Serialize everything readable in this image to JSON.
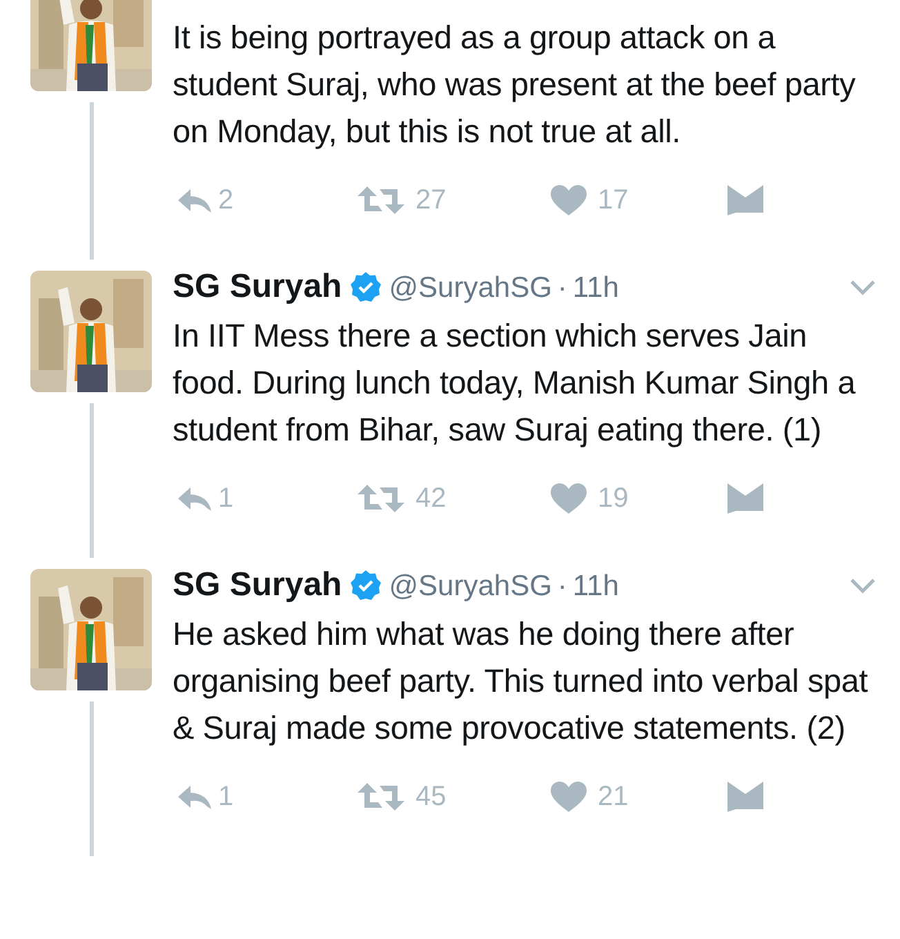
{
  "tweets": [
    {
      "text": "It is being portrayed as a group attack on a student Suraj, who was present at the beef party on Monday, but this is not true at all.",
      "replies": "2",
      "retweets": "27",
      "likes": "17"
    },
    {
      "author": "SG Suryah",
      "verified": true,
      "handle": "@SuryahSG",
      "separator": "·",
      "time": "11h",
      "text": "In IIT Mess there a section which serves Jain food. During lunch today, Manish Kumar Singh a student from Bihar, saw Suraj eating there. (1)",
      "replies": "1",
      "retweets": "42",
      "likes": "19"
    },
    {
      "author": "SG Suryah",
      "verified": true,
      "handle": "@SuryahSG",
      "separator": "·",
      "time": "11h",
      "text": "He asked him what was he doing there after organising beef party. This turned into verbal spat & Suraj made some provocative statements. (2)",
      "replies": "1",
      "retweets": "45",
      "likes": "21"
    }
  ]
}
